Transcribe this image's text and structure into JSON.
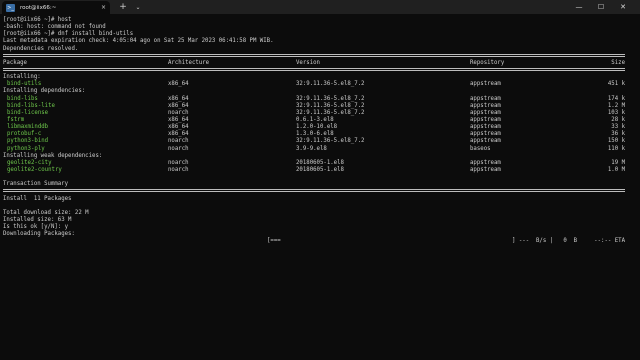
{
  "window": {
    "tab_title": "root@iix66:~",
    "tab_icon_glyph": ">_",
    "tab_close": "×",
    "new_tab": "+",
    "dropdown": "⌄",
    "minimize": "—",
    "maximize": "☐",
    "close": "✕",
    "colors": {
      "background": "#0c0c0c",
      "titlebar": "#202020",
      "text": "#cccccc",
      "package_name": "#6ec84b"
    }
  },
  "terminal": {
    "lines": [
      "[root@iix66 ~]# host",
      "-bash: host: command not found",
      "[root@iix66 ~]# dnf install bind-utils",
      "Last metadata expiration check: 4:05:04 ago on Sat 25 Mar 2023 06:41:58 PM WIB.",
      "Dependencies resolved."
    ],
    "table_header": {
      "package": "Package",
      "architecture": "Architecture",
      "version": "Version",
      "repository": "Repository",
      "size": "Size"
    },
    "sections": {
      "installing": "Installing:",
      "installing_deps": "Installing dependencies:",
      "installing_weak": "Installing weak dependencies:"
    },
    "installing": [
      {
        "name": "bind-utils",
        "arch": "x86_64",
        "version": "32:9.11.36-5.el8_7.2",
        "repo": "appstream",
        "size": "451 k"
      }
    ],
    "dependencies": [
      {
        "name": "bind-libs",
        "arch": "x86_64",
        "version": "32:9.11.36-5.el8_7.2",
        "repo": "appstream",
        "size": "174 k"
      },
      {
        "name": "bind-libs-lite",
        "arch": "x86_64",
        "version": "32:9.11.36-5.el8_7.2",
        "repo": "appstream",
        "size": "1.2 M"
      },
      {
        "name": "bind-license",
        "arch": "noarch",
        "version": "32:9.11.36-5.el8_7.2",
        "repo": "appstream",
        "size": "103 k"
      },
      {
        "name": "fstrm",
        "arch": "x86_64",
        "version": "0.6.1-3.el8",
        "repo": "appstream",
        "size": "28 k"
      },
      {
        "name": "libmaxminddb",
        "arch": "x86_64",
        "version": "1.2.0-10.el8",
        "repo": "appstream",
        "size": "33 k"
      },
      {
        "name": "protobuf-c",
        "arch": "x86_64",
        "version": "1.3.0-6.el8",
        "repo": "appstream",
        "size": "36 k"
      },
      {
        "name": "python3-bind",
        "arch": "noarch",
        "version": "32:9.11.36-5.el8_7.2",
        "repo": "appstream",
        "size": "150 k"
      },
      {
        "name": "python3-ply",
        "arch": "noarch",
        "version": "3.9-9.el8",
        "repo": "baseos",
        "size": "110 k"
      }
    ],
    "weak": [
      {
        "name": "geolite2-city",
        "arch": "noarch",
        "version": "20180605-1.el8",
        "repo": "appstream",
        "size": "19 M"
      },
      {
        "name": "geolite2-country",
        "arch": "noarch",
        "version": "20180605-1.el8",
        "repo": "appstream",
        "size": "1.0 M"
      }
    ],
    "summary": {
      "title": "Transaction Summary",
      "install": "Install  11 Packages",
      "download_size": "Total download size: 22 M",
      "installed_size": "Installed size: 63 M",
      "prompt": "Is this ok [y/N]: y",
      "downloading": "Downloading Packages:"
    },
    "progress": {
      "bar_left": "[===",
      "bar_right": "] ---  B/s |   0  B     --:-- ETA"
    }
  }
}
